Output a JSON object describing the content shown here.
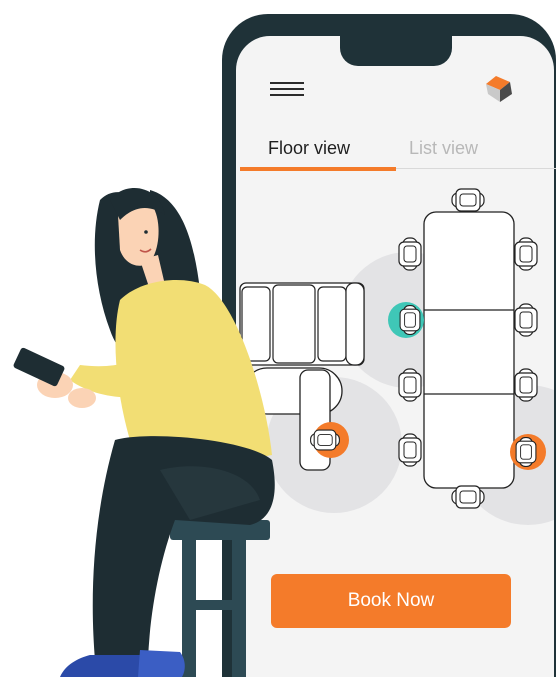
{
  "app": {
    "menu_icon": "hamburger-menu-icon",
    "logo_icon": "cube-logo-icon"
  },
  "tabs": [
    {
      "label": "Floor view",
      "active": true
    },
    {
      "label": "List view",
      "active": false
    }
  ],
  "book_button": {
    "label": "Book Now"
  },
  "colors": {
    "accent": "#f47b2a",
    "available_seat": "#3fc7b7",
    "booked_seat": "#f47b2a",
    "phone_frame": "#1f3238",
    "screen_bg": "#f4f4f4"
  }
}
